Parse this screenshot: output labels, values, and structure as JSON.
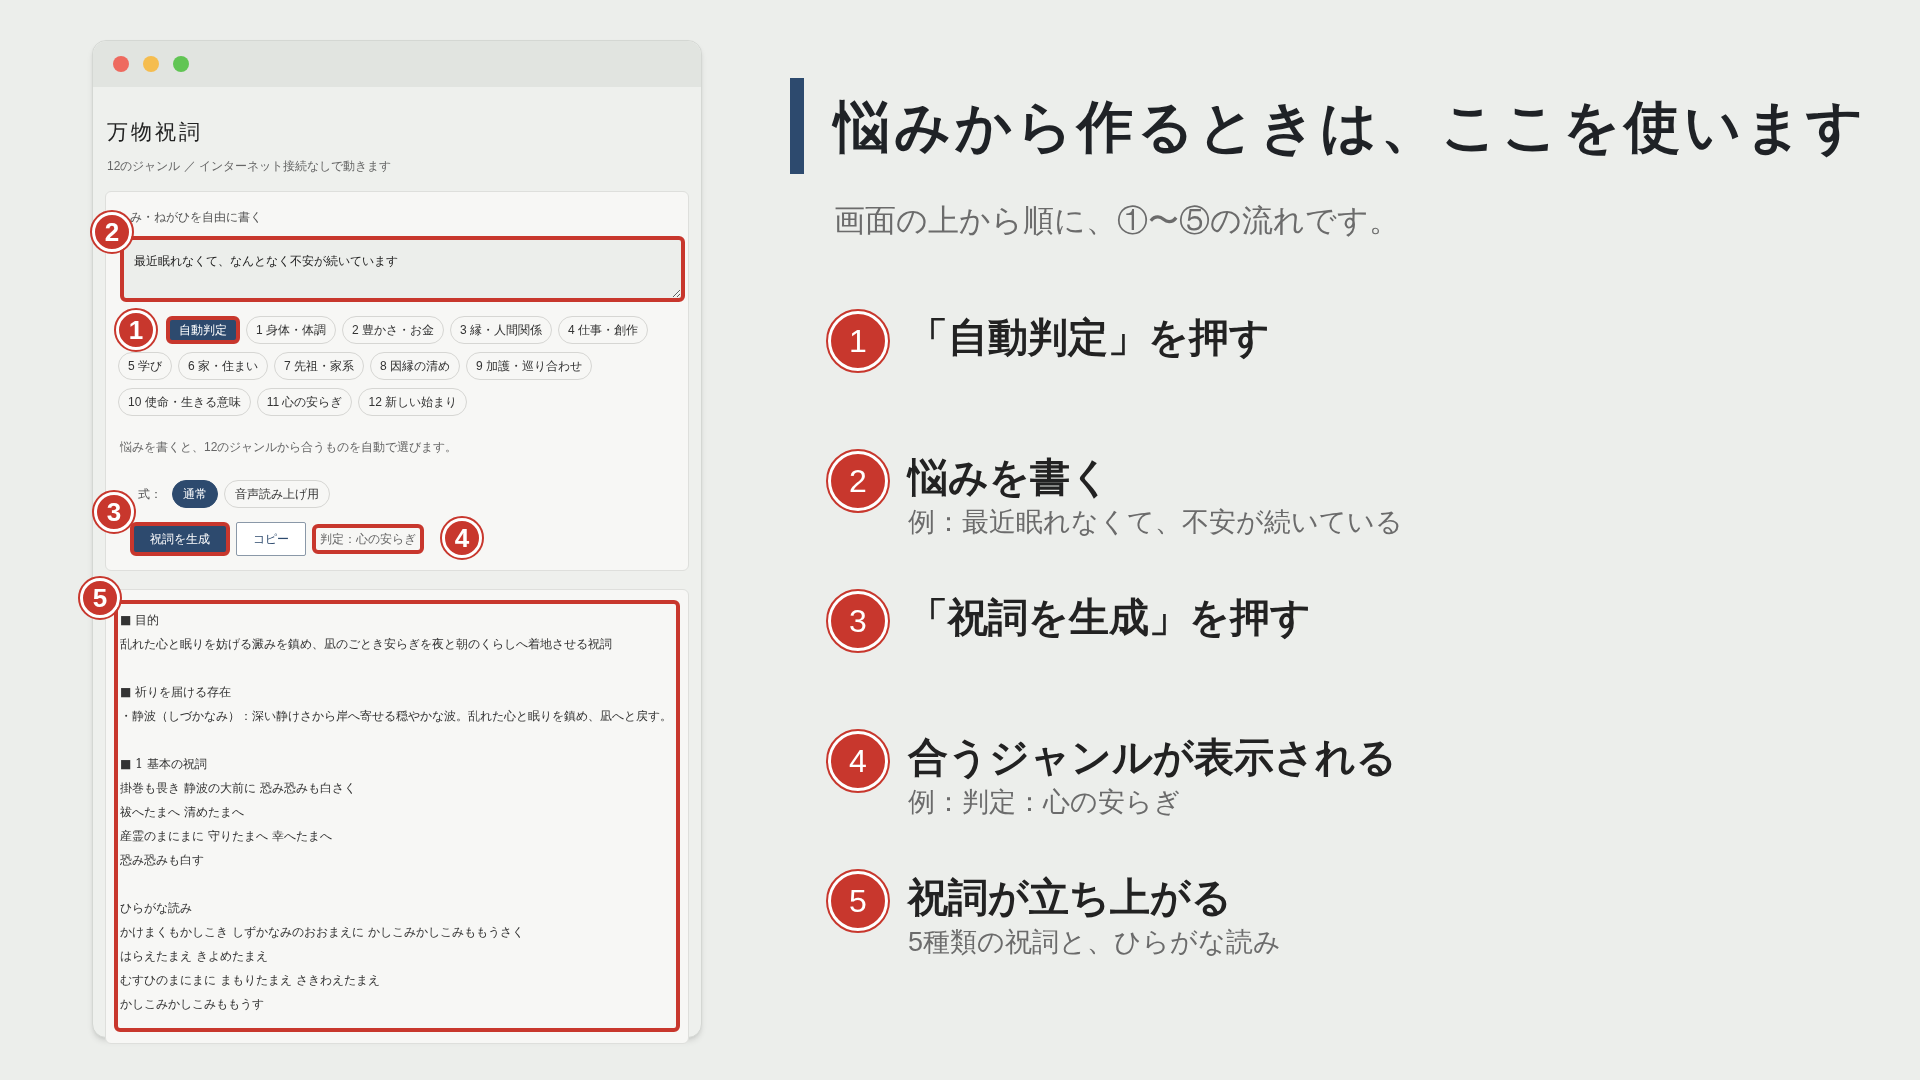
{
  "app_window": {
    "title": "万物祝詞",
    "subtitle": "12のジャンル ／ インターネット接続なしで動きます",
    "input": {
      "label": "み・ねがひを自由に書く",
      "value": "最近眠れなくて、なんとなく不安が続いています",
      "callout": "2"
    },
    "genres": [
      {
        "label": "自動判定",
        "selected": true,
        "callout": "1"
      },
      {
        "label": "1 身体・体調",
        "selected": false
      },
      {
        "label": "2 豊かさ・お金",
        "selected": false
      },
      {
        "label": "3 縁・人間関係",
        "selected": false
      },
      {
        "label": "4 仕事・創作",
        "selected": false
      },
      {
        "label": "5 学び",
        "selected": false
      },
      {
        "label": "6 家・住まい",
        "selected": false
      },
      {
        "label": "7 先祖・家系",
        "selected": false
      },
      {
        "label": "8 因縁の清め",
        "selected": false
      },
      {
        "label": "9 加護・巡り合わせ",
        "selected": false
      },
      {
        "label": "10 使命・生きる意味",
        "selected": false
      },
      {
        "label": "11 心の安らぎ",
        "selected": false
      },
      {
        "label": "12 新しい始まり",
        "selected": false
      }
    ],
    "hint": "悩みを書くと、12のジャンルから合うものを自動で選びます。",
    "format": {
      "label": "式：",
      "options": [
        {
          "label": "通常",
          "selected": true
        },
        {
          "label": "音声読み上げ用",
          "selected": false
        }
      ]
    },
    "buttons": [
      {
        "label": "祝詞を生成",
        "kind": "primary",
        "callout": "3"
      },
      {
        "label": "コピー",
        "kind": "secondary"
      }
    ],
    "verdict": {
      "text": "判定：心の安らぎ",
      "callout": "4"
    },
    "result": {
      "callout": "5",
      "sections": [
        {
          "lines": [
            "■ 目的",
            "乱れた心と眠りを妨げる澱みを鎮め、凪のごとき安らぎを夜と朝のくらしへ着地させる祝詞"
          ]
        },
        {
          "lines": [
            "■ 祈りを届ける存在",
            "・静波（しづかなみ）：深い静けさから岸へ寄せる穏やかな波。乱れた心と眠りを鎮め、凪へと戻す。"
          ]
        },
        {
          "lines": [
            "■ 1 基本の祝詞",
            "掛巻も畏き 静波の大前に 恐み恐みも白さく",
            "祓へたまへ 清めたまへ",
            "産霊のまにまに 守りたまへ 幸へたまへ",
            "恐み恐みも白す"
          ]
        },
        {
          "lines": [
            "ひらがな読み",
            "かけまくもかしこき しずかなみのおおまえに かしこみかしこみももうさく",
            "はらえたまえ きよめたまえ",
            "むすひのまにまに まもりたまえ さきわえたまえ",
            "かしこみかしこみももうす"
          ]
        }
      ]
    }
  },
  "guide": {
    "title": "悩みから作るときは、ここを使います",
    "subtitle": "画面の上から順に、①〜⑤の流れです。",
    "steps": [
      {
        "number": "1",
        "title": "「自動判定」を押す"
      },
      {
        "number": "2",
        "title": "悩みを書く",
        "note": "例：最近眠れなくて、不安が続いている"
      },
      {
        "number": "3",
        "title": "「祝詞を生成」を押す"
      },
      {
        "number": "4",
        "title": "合うジャンルが表示される",
        "note": "例：判定：心の安らぎ"
      },
      {
        "number": "5",
        "title": "祝詞が立ち上がる",
        "note": "5種類の祝詞と、ひらがな読み"
      }
    ]
  }
}
